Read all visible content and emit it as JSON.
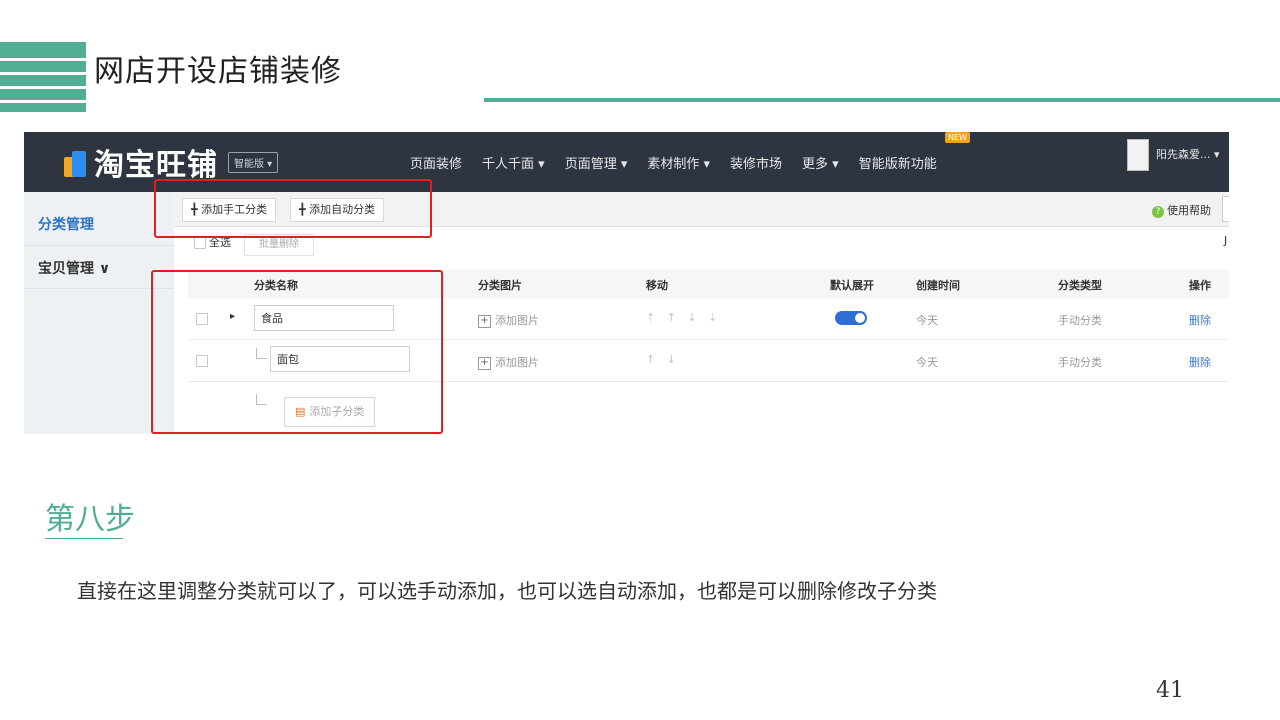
{
  "slide": {
    "title": "网店开设店铺装修",
    "step_title": "第八步",
    "description": "直接在这里调整分类就可以了，可以选手动添加，也可以选自动添加，也都是可以删除修改子分类",
    "page_number": "41",
    "accent_color": "#4fae93"
  },
  "app": {
    "logo_text": "淘宝旺铺",
    "edition": "智能版 ▾",
    "nav": [
      "页面装修",
      "千人千面 ▾",
      "页面管理 ▾",
      "素材制作 ▾",
      "装修市场",
      "更多 ▾",
      "智能版新功能"
    ],
    "new_badge": "NEW",
    "user": "阳先森爱... ▾"
  },
  "sidebar": {
    "items": [
      {
        "label": "分类管理",
        "active": true
      },
      {
        "label": "宝贝管理 ∨",
        "active": false
      }
    ]
  },
  "toolbar": {
    "add_manual": "╋ 添加手工分类",
    "add_auto": "╋ 添加自动分类",
    "help": "使用帮助",
    "help_icon": "?"
  },
  "selection": {
    "select_all": "全选",
    "batch_delete": "批量删除",
    "edge_mark": "J"
  },
  "table": {
    "headers": [
      "分类名称",
      "分类图片",
      "移动",
      "默认展开",
      "创建时间",
      "分类类型",
      "操作"
    ],
    "rows": [
      {
        "name": "食品",
        "image": "添加图片",
        "move": "⇡ ↑ ↓ ⇣",
        "expand": true,
        "created": "今天",
        "type": "手动分类",
        "action": "删除"
      },
      {
        "name": "面包",
        "image": "添加图片",
        "move": "↑ ↓",
        "expand": false,
        "created": "今天",
        "type": "手动分类",
        "action": "删除"
      }
    ],
    "add_subcategory": "添加子分类",
    "add_subcategory_icon": "▤"
  }
}
